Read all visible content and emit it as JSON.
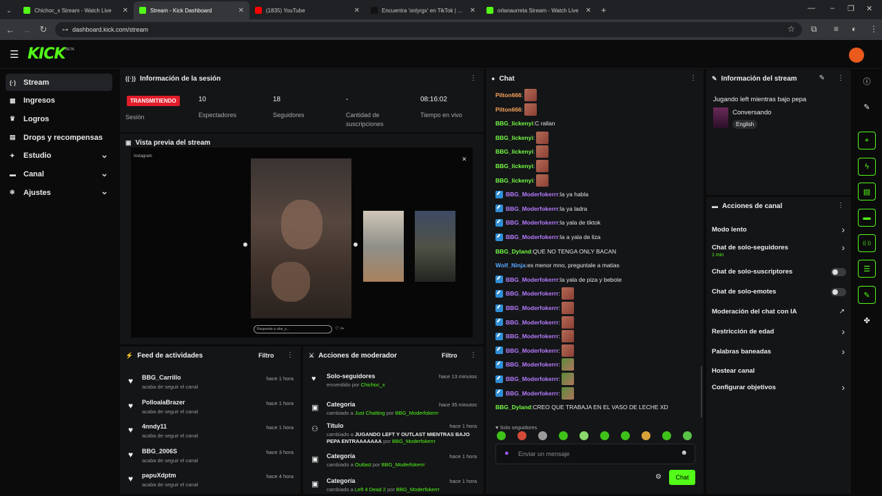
{
  "browser": {
    "tabs": [
      {
        "title": "Chichoc_x Stream - Watch Live",
        "color": "#53fc18",
        "active": false
      },
      {
        "title": "Stream - Kick Dashboard",
        "color": "#53fc18",
        "active": true
      },
      {
        "title": "(1835) YouTube",
        "color": "#ff0000",
        "active": false
      },
      {
        "title": "Encuentra 'onlyrgx' en TikTok | ...",
        "color": "#111111",
        "active": false
      },
      {
        "title": "orlanaurreta Stream - Watch Live",
        "color": "#53fc18",
        "active": false
      }
    ],
    "url": "dashboard.kick.com/stream"
  },
  "brand": {
    "logo": "KICK",
    "beta": "BETA",
    "accent": "#53fc18"
  },
  "sidebar": {
    "items": [
      {
        "label": "Stream",
        "icon": "broadcast-icon",
        "glyph": "(·)",
        "active": true,
        "expandable": false
      },
      {
        "label": "Ingresos",
        "icon": "revenue-icon",
        "glyph": "▦",
        "active": false,
        "expandable": false
      },
      {
        "label": "Logros",
        "icon": "trophy-icon",
        "glyph": "♛",
        "active": false,
        "expandable": false
      },
      {
        "label": "Drops y recompensas",
        "icon": "gift-icon",
        "glyph": "▤",
        "active": false,
        "expandable": false
      },
      {
        "label": "Estudio",
        "icon": "studio-icon",
        "glyph": "✦",
        "active": false,
        "expandable": true
      },
      {
        "label": "Canal",
        "icon": "channel-icon",
        "glyph": "▬",
        "active": false,
        "expandable": true
      },
      {
        "label": "Ajustes",
        "icon": "settings-icon",
        "glyph": "✻",
        "active": false,
        "expandable": true
      }
    ]
  },
  "session": {
    "title": "Información de la sesión",
    "status_badge": "TRANSMITIENDO",
    "status_label": "Sesión",
    "stats": [
      {
        "value": "10",
        "label": "Espectadores"
      },
      {
        "value": "18",
        "label": "Seguidores"
      },
      {
        "value": "-",
        "label": "Cantidad de suscripciones"
      },
      {
        "value": "08:16:02",
        "label": "Tiempo en vivo"
      }
    ]
  },
  "preview": {
    "title": "Vista previa del stream",
    "overlay_label": "Instagram",
    "reply_placeholder": "Responde a vibe_s..."
  },
  "feed": {
    "title": "Feed de actividades",
    "filter_label": "Filtro",
    "items": [
      {
        "name": "BBG_Carrillo",
        "action": "acaba de seguir el canal",
        "time": "hace 1 hora"
      },
      {
        "name": "PolloalaBrazer",
        "action": "acaba de seguir el canal",
        "time": "hace 1 hora"
      },
      {
        "name": "4nndy11",
        "action": "acaba de seguir el canal",
        "time": "hace 1 hora"
      },
      {
        "name": "BBG_2006S",
        "action": "acaba de seguir el canal",
        "time": "hace 3 hora"
      },
      {
        "name": "papuXdptm",
        "action": "acaba de seguir el canal",
        "time": "hace 4 hora"
      }
    ]
  },
  "modactions": {
    "title": "Acciones de moderador",
    "filter_label": "Filtro",
    "items": [
      {
        "title": "Solo-seguidores",
        "icon": "heart-icon",
        "time": "hace 13 minutos",
        "parts": [
          [
            "t",
            "encendido por "
          ],
          [
            "g",
            "Chichoc_x"
          ]
        ]
      },
      {
        "title": "Categoría",
        "icon": "category-icon",
        "time": "hace 35 minutos",
        "parts": [
          [
            "t",
            "cambiado a "
          ],
          [
            "g",
            "Just Chatting"
          ],
          [
            "t",
            " por "
          ],
          [
            "g",
            "BBG_Moderfokerrr"
          ]
        ]
      },
      {
        "title": "Título",
        "icon": "title-icon",
        "time": "hace 1 hora",
        "parts": [
          [
            "t",
            "cambiado a "
          ],
          [
            "w",
            "JUGANDO LEFT Y OUTLAST MIENTRAS BAJO PEPA ENTRAAAAAAA"
          ],
          [
            "t",
            " por "
          ],
          [
            "g",
            "BBG_Moderfokerrr"
          ]
        ]
      },
      {
        "title": "Categoría",
        "icon": "category-icon",
        "time": "hace 1 hora",
        "parts": [
          [
            "t",
            "cambiado a "
          ],
          [
            "g",
            "Outlast"
          ],
          [
            "t",
            " por "
          ],
          [
            "g",
            "BBG_Moderfokerrr"
          ]
        ]
      },
      {
        "title": "Categoría",
        "icon": "category-icon",
        "time": "hace 1 hora",
        "parts": [
          [
            "t",
            "cambiado a "
          ],
          [
            "g",
            "Left 4 Dead 2"
          ],
          [
            "t",
            " por "
          ],
          [
            "g",
            "BBG_Moderfokerrr"
          ]
        ]
      }
    ]
  },
  "chat": {
    "title": "Chat",
    "messages": [
      {
        "user": "Pilton666",
        "color": "#f7a35c",
        "mod": false,
        "text": "",
        "emote": "a"
      },
      {
        "user": "Pilton666",
        "color": "#f7a35c",
        "mod": false,
        "text": "",
        "emote": "a"
      },
      {
        "user": "BBG_lickenyi",
        "color": "#75fd46",
        "mod": false,
        "text": "C rallan",
        "emote": ""
      },
      {
        "user": "BBG_lickenyi",
        "color": "#75fd46",
        "mod": false,
        "text": "",
        "emote": "a"
      },
      {
        "user": "BBG_lickenyi",
        "color": "#75fd46",
        "mod": false,
        "text": "",
        "emote": "a"
      },
      {
        "user": "BBG_lickenyi",
        "color": "#75fd46",
        "mod": false,
        "text": "",
        "emote": "a"
      },
      {
        "user": "BBG_lickenyi",
        "color": "#75fd46",
        "mod": false,
        "text": "",
        "emote": "a"
      },
      {
        "user": "BBG_Moderfokerrr",
        "color": "#b57cff",
        "mod": true,
        "text": "la ya habla",
        "emote": ""
      },
      {
        "user": "BBG_Moderfokerrr",
        "color": "#b57cff",
        "mod": true,
        "text": "la ya ladra",
        "emote": ""
      },
      {
        "user": "BBG_Moderfokerrr",
        "color": "#b57cff",
        "mod": true,
        "text": "la yala de tiktok",
        "emote": ""
      },
      {
        "user": "BBG_Moderfokerrr",
        "color": "#b57cff",
        "mod": true,
        "text": "la a yala de liza",
        "emote": ""
      },
      {
        "user": "BBG_Dyland",
        "color": "#75fd46",
        "mod": false,
        "text": "QUE NO TENGA ONLY BACAN",
        "emote": ""
      },
      {
        "user": "Wolf_Ninja",
        "color": "#5aa9ff",
        "mod": false,
        "text": "es menor mno, preguntale a matias",
        "emote": ""
      },
      {
        "user": "BBG_Moderfokerrr",
        "color": "#b57cff",
        "mod": true,
        "text": "la yala de piza y bebote",
        "emote": ""
      },
      {
        "user": "BBG_Moderfokerrr",
        "color": "#b57cff",
        "mod": true,
        "text": "",
        "emote": "a"
      },
      {
        "user": "BBG_Moderfokerrr",
        "color": "#b57cff",
        "mod": true,
        "text": "",
        "emote": "a"
      },
      {
        "user": "BBG_Moderfokerrr",
        "color": "#b57cff",
        "mod": true,
        "text": "",
        "emote": "a"
      },
      {
        "user": "BBG_Moderfokerrr",
        "color": "#b57cff",
        "mod": true,
        "text": "",
        "emote": "a"
      },
      {
        "user": "BBG_Moderfokerrr",
        "color": "#b57cff",
        "mod": true,
        "text": "",
        "emote": "a"
      },
      {
        "user": "BBG_Moderfokerrr",
        "color": "#b57cff",
        "mod": true,
        "text": "",
        "emote": "b"
      },
      {
        "user": "BBG_Moderfokerrr",
        "color": "#b57cff",
        "mod": true,
        "text": "",
        "emote": "b"
      },
      {
        "user": "BBG_Moderfokerrr",
        "color": "#b57cff",
        "mod": true,
        "text": "",
        "emote": "b"
      },
      {
        "user": "BBG_Dyland",
        "color": "#75fd46",
        "mod": false,
        "text": "CREO QUE TRABAJA EN EL VASO DE LECHE XD",
        "emote": ""
      }
    ],
    "mode_label": "Solo seguidores",
    "input_placeholder": "Enviar un mensaje",
    "send_label": "Chat"
  },
  "stream_info": {
    "title": "Información del stream",
    "stream_title": "Jugando left mientras bajo pepa",
    "category": "Conversando",
    "language": "English"
  },
  "channel_actions": {
    "title": "Acciones de canal",
    "items": [
      {
        "label": "Modo lento",
        "sub": "",
        "control": "chevron"
      },
      {
        "label": "Chat de solo-seguidores",
        "sub": "1 min",
        "control": "chevron"
      },
      {
        "label": "Chat de solo-suscriptores",
        "sub": "",
        "control": "toggle"
      },
      {
        "label": "Chat de solo-emotes",
        "sub": "",
        "control": "toggle"
      },
      {
        "label": "Moderación del chat con IA",
        "sub": "",
        "control": "external"
      },
      {
        "label": "Restricción de edad",
        "sub": "",
        "control": "chevron"
      },
      {
        "label": "Palabras baneadas",
        "sub": "",
        "control": "chevron"
      },
      {
        "label": "Hostear canal",
        "sub": "",
        "control": "none"
      },
      {
        "label": "Configurar objetivos",
        "sub": "",
        "control": "chevron"
      }
    ]
  },
  "rail_icons": [
    "info-icon",
    "pencil-icon",
    "target-icon",
    "bolt-icon",
    "clipboard-icon",
    "chat-icon",
    "broadcast-icon",
    "layout-icon",
    "wrench-icon",
    "puzzle-icon"
  ]
}
